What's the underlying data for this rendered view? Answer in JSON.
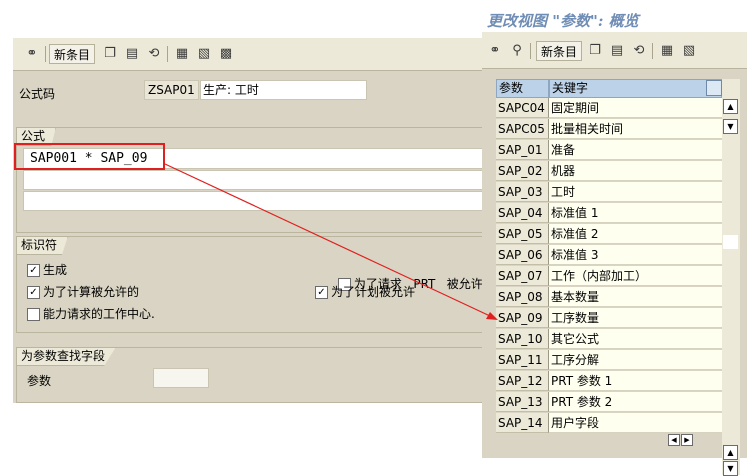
{
  "left_window": {
    "toolbar": {
      "new_entries_label": "新条目",
      "icons": [
        "glasses-icon",
        "copy-icon",
        "delete-icon",
        "undo-icon",
        "select-all-icon",
        "select-block-icon",
        "deselect-icon"
      ]
    },
    "formula_code": {
      "label": "公式码",
      "code": "ZSAP01",
      "description": "生产: 工时"
    },
    "formula_group": {
      "title": "公式",
      "line1": "SAP001 * SAP_09",
      "line2": "",
      "line3": ""
    },
    "indicators": {
      "title": "标识符",
      "generate": {
        "label": "生成",
        "checked": true
      },
      "allowed_for_cost_calc": {
        "label": "为了计算被允许的",
        "checked": true
      },
      "capacity_requirements": {
        "label": "能力请求的工作中心.",
        "checked": false
      },
      "for_request_prt": {
        "label": "为了请求   PRT   被允许",
        "checked": false
      },
      "for_scheduling": {
        "label": "为了计划被允许",
        "checked": true
      }
    },
    "param_search": {
      "title": "为参数查找字段",
      "param_label": "参数",
      "param_value": ""
    }
  },
  "right_window": {
    "title": "更改视图 \"参数\": 概览",
    "toolbar": {
      "new_entries_label": "新条目",
      "icons": [
        "glasses-icon",
        "find-icon",
        "copy-icon",
        "delete-icon",
        "undo-icon",
        "select-all-icon",
        "select-block-icon"
      ]
    },
    "table": {
      "columns": [
        "参数",
        "关键字"
      ],
      "rows": [
        {
          "param": "SAPC04",
          "keyword": "固定期间"
        },
        {
          "param": "SAPC05",
          "keyword": "批量相关时间"
        },
        {
          "param": "SAP_01",
          "keyword": "准备"
        },
        {
          "param": "SAP_02",
          "keyword": "机器"
        },
        {
          "param": "SAP_03",
          "keyword": "工时"
        },
        {
          "param": "SAP_04",
          "keyword": "标准值 1"
        },
        {
          "param": "SAP_05",
          "keyword": "标准值 2"
        },
        {
          "param": "SAP_06",
          "keyword": "标准值 3"
        },
        {
          "param": "SAP_07",
          "keyword": "工作（内部加工）"
        },
        {
          "param": "SAP_08",
          "keyword": "基本数量"
        },
        {
          "param": "SAP_09",
          "keyword": "工序数量"
        },
        {
          "param": "SAP_10",
          "keyword": "其它公式"
        },
        {
          "param": "SAP_11",
          "keyword": "工序分解"
        },
        {
          "param": "SAP_12",
          "keyword": "PRT 参数 1"
        },
        {
          "param": "SAP_13",
          "keyword": "PRT 参数 2"
        },
        {
          "param": "SAP_14",
          "keyword": "用户字段"
        }
      ]
    }
  },
  "colors": {
    "highlight_box": "#e02020",
    "arrow": "#e02020",
    "header_blue": "#bcd2e8",
    "panel_bg": "#d9d4c3",
    "title_color": "#6f8db5"
  }
}
